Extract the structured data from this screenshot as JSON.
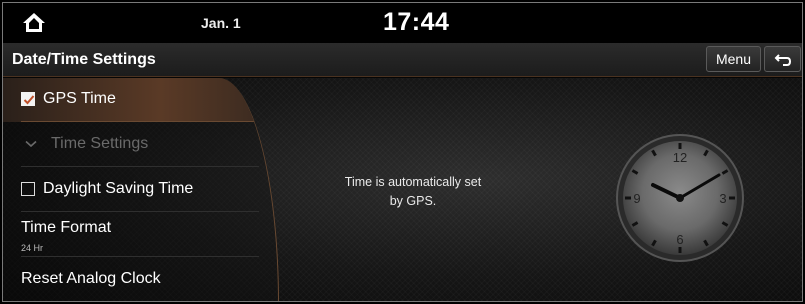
{
  "status": {
    "date": "Jan. 1",
    "time": "17:44"
  },
  "header": {
    "title": "Date/Time Settings",
    "menu_label": "Menu"
  },
  "sidebar": {
    "items": [
      {
        "label": "GPS Time",
        "checked": true
      },
      {
        "label": "Time Settings",
        "disabled": true
      },
      {
        "label": "Daylight Saving Time",
        "checked": false
      },
      {
        "label": "Time Format",
        "value": "24 Hr"
      },
      {
        "label": "Reset Analog Clock"
      }
    ]
  },
  "main": {
    "info_line1": "Time is automatically set",
    "info_line2": "by GPS."
  },
  "clock": {
    "numerals": [
      "12",
      "3",
      "6",
      "9"
    ]
  },
  "colors": {
    "accent": "#b8744a",
    "selected_row": "#5a3a26"
  },
  "icons": {
    "home": "home-icon",
    "back": "back-arrow-icon",
    "check": "checkmark-icon",
    "chevron": "chevron-down-icon"
  }
}
